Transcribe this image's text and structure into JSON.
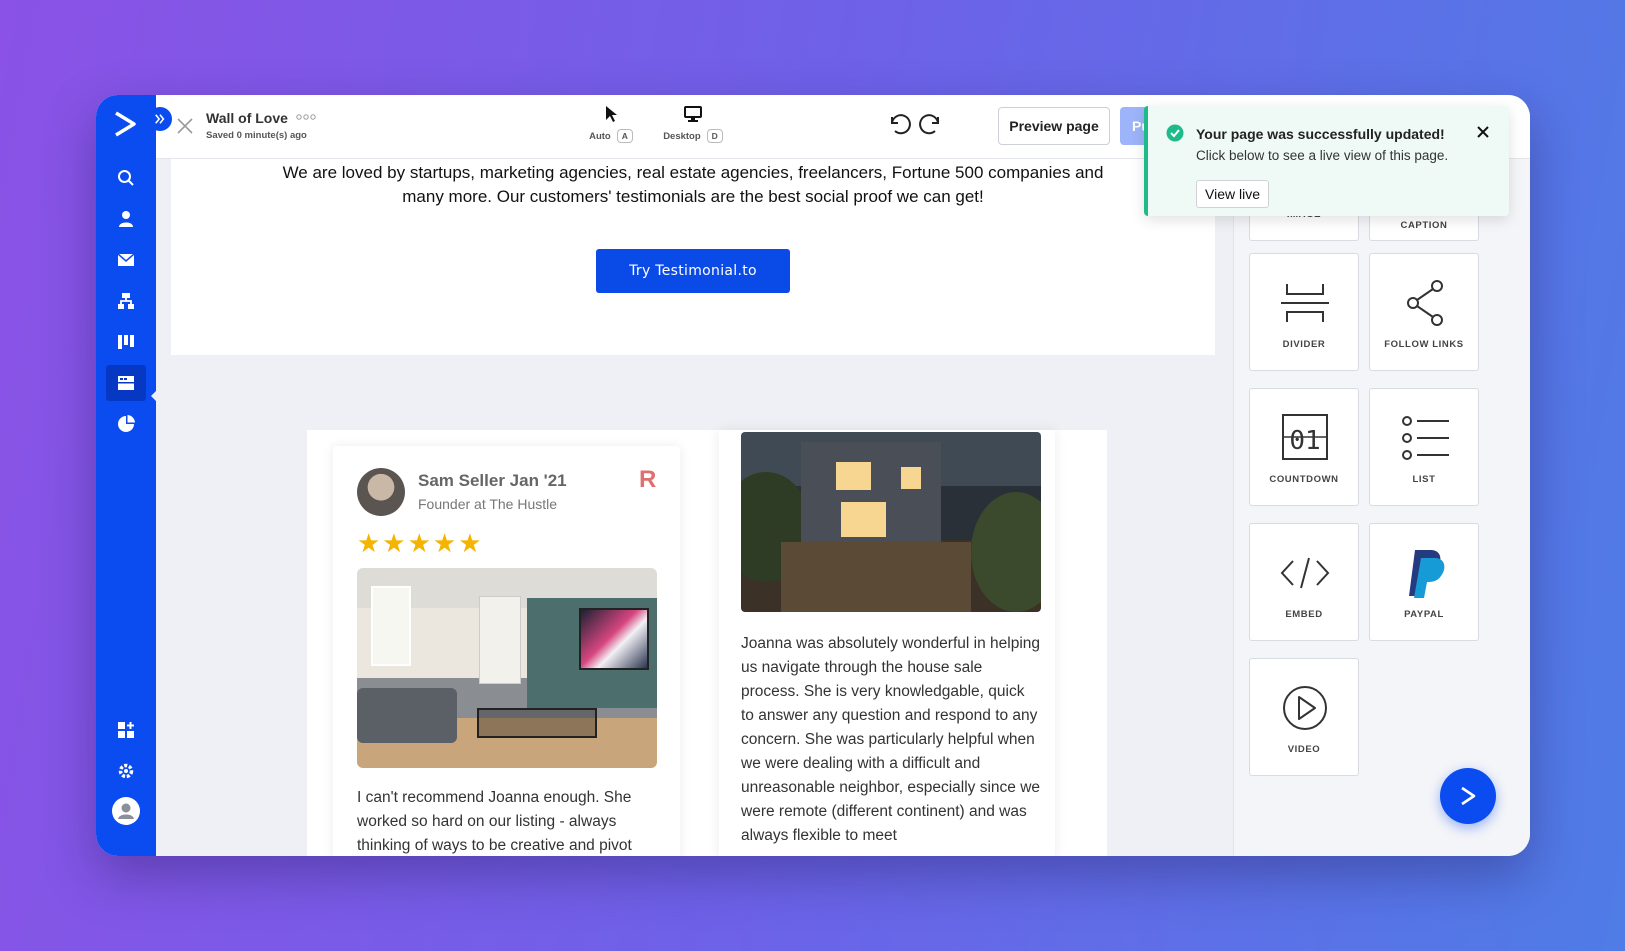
{
  "colors": {
    "brand_blue": "#0b4cf0",
    "success_green": "#1fba8a",
    "star_gold": "#f4b400"
  },
  "topbar": {
    "page_title": "Wall of Love",
    "saved_status": "Saved 0 minute(s) ago",
    "modes": [
      {
        "label": "Auto",
        "key": "A",
        "icon": "cursor-icon"
      },
      {
        "label": "Desktop",
        "key": "D",
        "icon": "monitor-icon"
      }
    ],
    "preview_label": "Preview page",
    "publish_label": "Pu"
  },
  "rail": {
    "items": [
      "search-icon",
      "contacts-icon",
      "email-icon",
      "automation-icon",
      "pipeline-icon",
      "pages-icon",
      "reports-icon"
    ],
    "bottom_items": [
      "apps-icon",
      "settings-icon",
      "account-icon"
    ]
  },
  "hero": {
    "text": "We are loved by startups, marketing agencies, real estate agencies, freelancers, Fortune 500 companies and many more. Our customers' testimonials are the best social proof we can get!",
    "cta_label": "Try Testimonial.to"
  },
  "testimonials": [
    {
      "author": "Sam Seller Jan '21",
      "role": "Founder at The Hustle",
      "source_logo": "R",
      "stars": "★★★★★",
      "rating": 5,
      "quote": "I can't recommend Joanna enough. She worked so hard on our listing - always thinking of ways to be creative and pivot"
    },
    {
      "quote": "Joanna was absolutely wonderful in helping us navigate through the house sale process. She is very knowledgable, quick to answer any question and respond to any concern. She was particularly helpful when we were dealing with a difficult and unreasonable neighbor, especially since we were remote (different continent) and was always flexible to meet"
    }
  ],
  "panel": {
    "tiles": [
      {
        "label": "IMAGE",
        "icon": "image-icon"
      },
      {
        "label": "IMAGE & CAPTION",
        "icon": "image-caption-icon"
      },
      {
        "label": "DIVIDER",
        "icon": "divider-icon"
      },
      {
        "label": "FOLLOW LINKS",
        "icon": "share-icon"
      },
      {
        "label": "COUNTDOWN",
        "icon": "countdown-icon"
      },
      {
        "label": "LIST",
        "icon": "list-icon"
      },
      {
        "label": "EMBED",
        "icon": "code-icon"
      },
      {
        "label": "PAYPAL",
        "icon": "paypal-icon"
      },
      {
        "label": "VIDEO",
        "icon": "play-icon"
      }
    ]
  },
  "toast": {
    "title": "Your page was successfully updated!",
    "message": "Click below to see a live view of this page.",
    "button_label": "View live"
  }
}
